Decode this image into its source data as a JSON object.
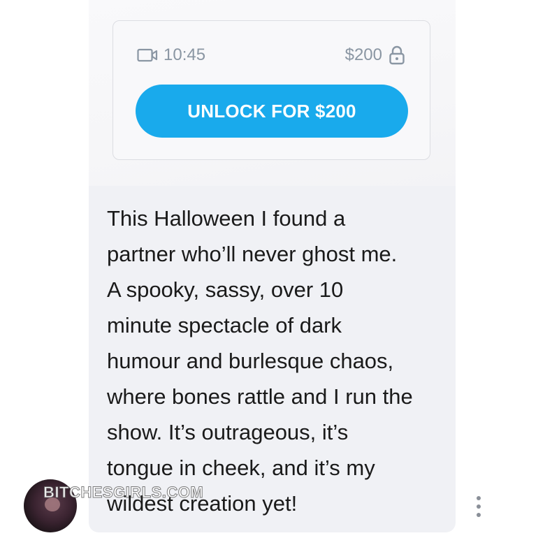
{
  "post": {
    "media": {
      "duration": "10:45",
      "price": "$200",
      "duration_icon": "video-camera-icon",
      "price_icon": "lock-icon"
    },
    "unlock_button_label": "UNLOCK FOR $200",
    "caption_lines": [
      "This Halloween I found a",
      "partner who’ll never ghost me.",
      "A spooky, sassy, over 10",
      "minute spectacle of dark",
      "humour and burlesque chaos,",
      "where bones rattle and I run the",
      "show. It’s outrageous, it’s",
      "tongue in cheek, and it’s my",
      "wildest creation yet!"
    ]
  },
  "watermark": "BITCHESGIRLS.COM",
  "icons": {
    "more": "more-vertical-icon",
    "avatar": "avatar"
  },
  "colors": {
    "accent": "#19aaec",
    "meta_text": "#8a96a3",
    "bubble_bg": "#f0f1f5",
    "text": "#1a1a1a"
  }
}
